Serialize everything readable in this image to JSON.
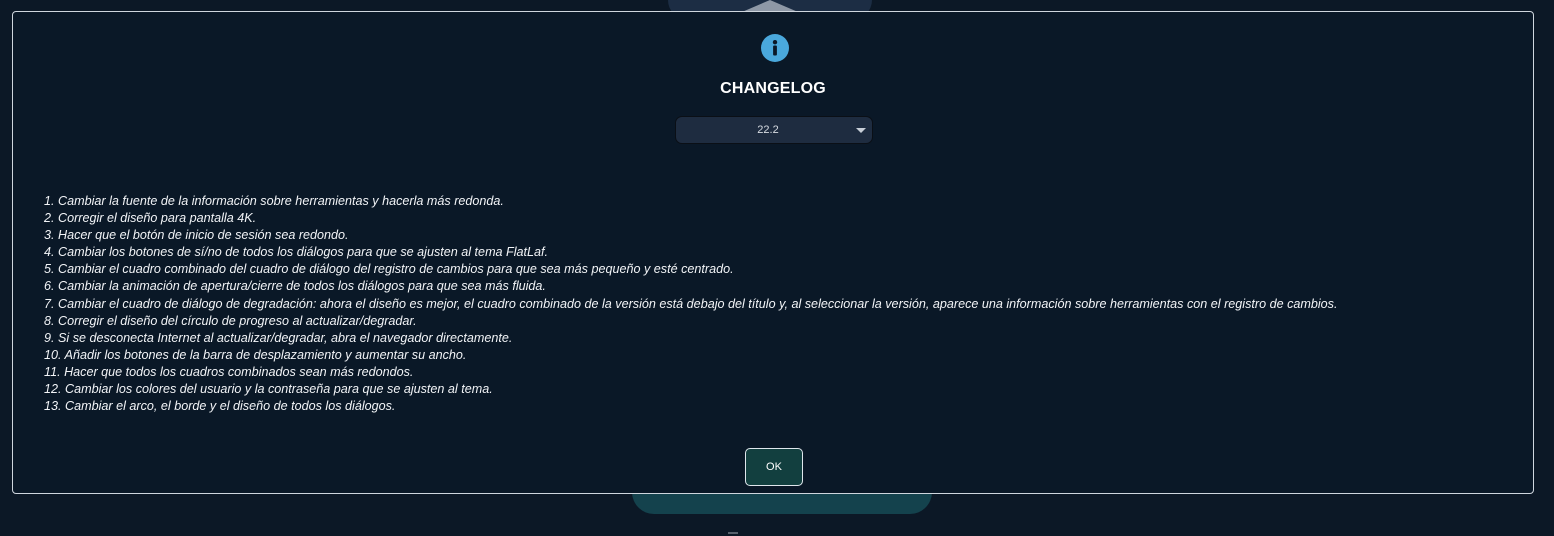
{
  "dialog": {
    "title": "CHANGELOG",
    "icon": "info-icon",
    "version_select": {
      "selected": "22.2"
    },
    "changelog_items": [
      "1. Cambiar la fuente de la información sobre herramientas y hacerla más redonda.",
      "2. Corregir el diseño para pantalla 4K.",
      "3. Hacer que el botón de inicio de sesión sea redondo.",
      "4. Cambiar los botones de sí/no de todos los diálogos para que se ajusten al tema FlatLaf.",
      "5. Cambiar el cuadro combinado del cuadro de diálogo del registro de cambios para que sea más pequeño y esté centrado.",
      "6. Cambiar la animación de apertura/cierre de todos los diálogos para que sea más fluida.",
      "7. Cambiar el cuadro de diálogo de degradación: ahora el diseño es mejor, el cuadro combinado de la versión está debajo del título y, al seleccionar la versión, aparece una información sobre herramientas con el registro de cambios.",
      "8. Corregir el diseño del círculo de progreso al actualizar/degradar.",
      "9. Si se desconecta Internet al actualizar/degradar, abra el navegador directamente.",
      "10. Añadir los botones de la barra de desplazamiento y aumentar su ancho.",
      "11. Hacer que todos los cuadros combinados sean más redondos.",
      "12. Cambiar los colores del usuario y la contraseña para que se ajusten al tema.",
      "13. Cambiar el arco, el borde y el diseño de todos los diálogos."
    ],
    "ok_label": "OK"
  },
  "colors": {
    "dialog_background": "#0a1827",
    "dialog_border": "#cfd6de",
    "info_icon": "#4aa8dc",
    "ok_button": "#123f3f",
    "select_background": "#1e2c40"
  }
}
